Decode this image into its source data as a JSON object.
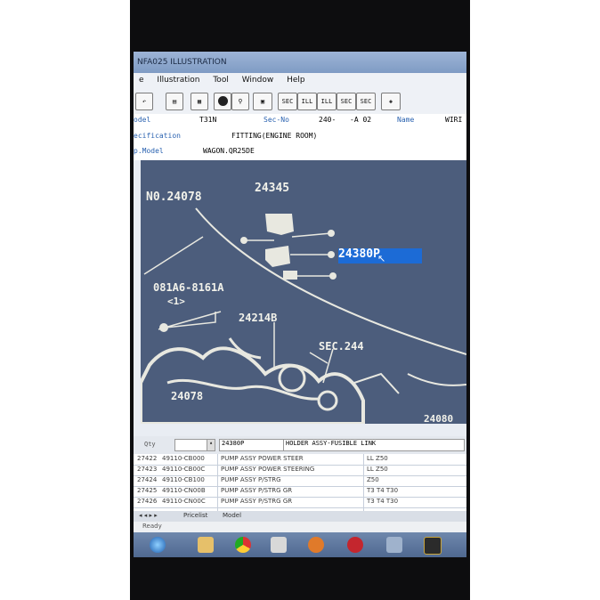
{
  "window": {
    "title": "NFA025 ILLUSTRATION"
  },
  "menu": [
    "e",
    "Illustration",
    "Tool",
    "Window",
    "Help"
  ],
  "toolbar": {
    "buttons": [
      "SEC",
      "SEC",
      "ILL",
      "ILL",
      "SEC",
      "SEC"
    ]
  },
  "info": {
    "model_label": "odel",
    "model_value": "T31N",
    "secno_label": "Sec-No",
    "secno_value": "240-",
    "secno_suffix": "-A 02",
    "name_label": "Name",
    "name_value": "WIRI",
    "spec_label": "ecification",
    "spec_value": "FITTING(ENGINE ROOM)",
    "appmodel_label": "p.Model",
    "appmodel_value": "WAGON.QR25DE"
  },
  "illustration": {
    "labels": [
      "N0.24078",
      "24345",
      "24380P",
      "081A6-8161A",
      "<1>",
      "24214B",
      "SEC.244",
      "24078",
      "24080"
    ],
    "selected_part": "24380P",
    "selection_color": "#1c6bd6",
    "background_color": "#4c5d7c"
  },
  "qty_bar": {
    "label": "Qty",
    "part_no": "24380P",
    "description": "HOLDER ASSY-FUSIBLE LINK"
  },
  "parts_table": [
    {
      "id": "27422",
      "part": "49110-CB000",
      "name": "PUMP ASSY POWER STEER",
      "spec": "LL Z50"
    },
    {
      "id": "27423",
      "part": "49110-CB00C",
      "name": "PUMP ASSY POWER STEERING",
      "spec": "LL Z50"
    },
    {
      "id": "27424",
      "part": "49110-CB100",
      "name": "PUMP ASSY P/STRG",
      "spec": "Z50"
    },
    {
      "id": "27425",
      "part": "49110-CN00B",
      "name": "PUMP ASSY P/STRG GR",
      "spec": "T3 T4 T30"
    },
    {
      "id": "27426",
      "part": "49110-CN00C",
      "name": "PUMP ASSY P/STRG GR",
      "spec": "T3 T4 T30"
    }
  ],
  "tabs": [
    "Pricelist",
    "Model"
  ],
  "status": "Ready",
  "taskbar_icons": [
    "start-orb-icon",
    "folder-icon",
    "chrome-icon",
    "app-icon",
    "media-icon",
    "nissan-icon",
    "blank-icon",
    "fast-icon"
  ]
}
